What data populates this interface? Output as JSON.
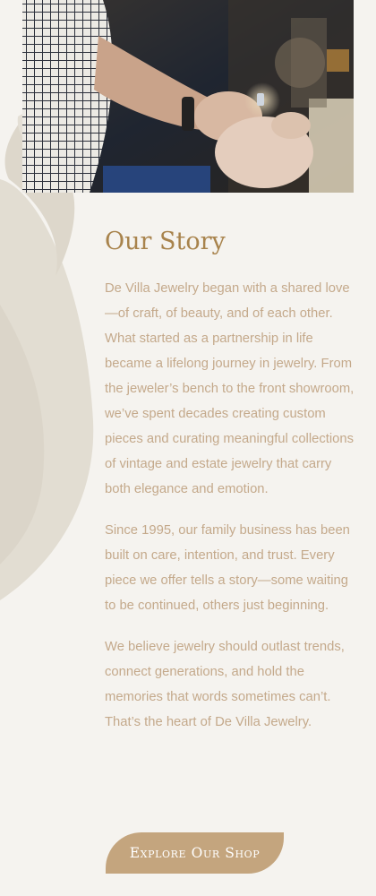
{
  "story": {
    "heading": "Our Story",
    "paragraphs": [
      "De Villa Jewelry began with a shared love—of craft, of beauty, and of each other. What started as a partnership in life became a lifelong journey in jewelry. From the jeweler’s bench to the front showroom, we’ve spent decades creating custom pieces and curating meaningful collections of vintage and estate jewelry that carry both elegance and emotion.",
      "Since 1995, our family business has been built on care, intention, and trust. Every piece we offer tells a story—some waiting to be continued, others just beginning.",
      "We believe jewelry should outlast trends, connect generations, and hold the memories that words sometimes can’t. That’s the heart of De Villa Jewelry."
    ]
  },
  "cta": {
    "label": "Explore Our Shop"
  },
  "colors": {
    "background": "#f5f3ef",
    "heading": "#a8834c",
    "body_text": "#c4a98b",
    "button": "#c4a57e",
    "button_text": "#ffffff",
    "decoration": "#dfd9cd"
  },
  "icons": {
    "decoration": "flame-ornament-icon"
  }
}
